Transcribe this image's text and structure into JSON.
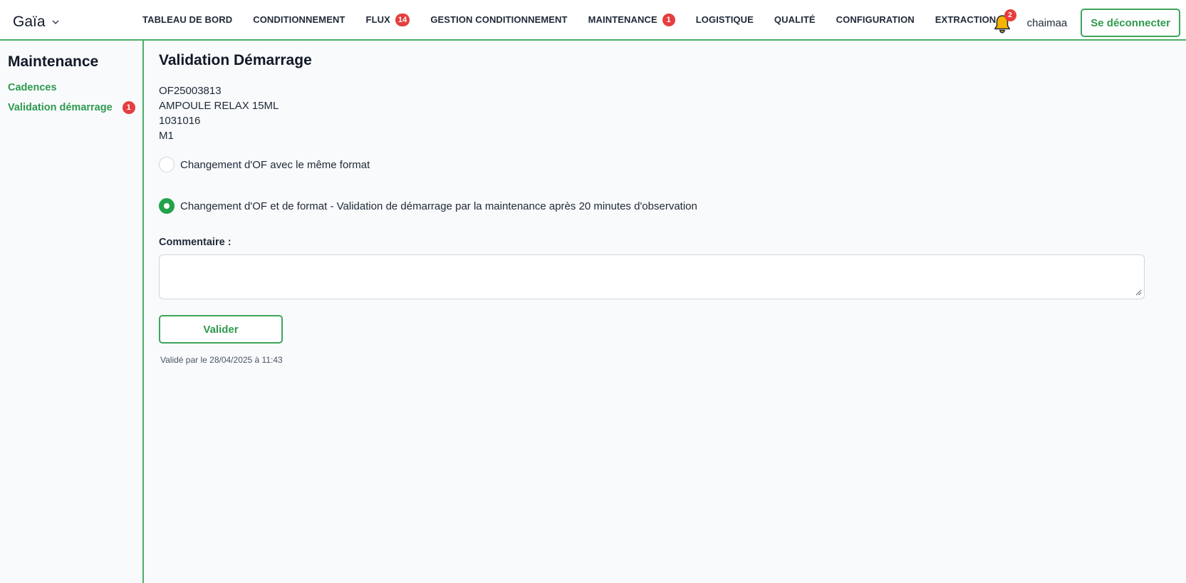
{
  "app": {
    "brand": "Gaïa"
  },
  "nav": {
    "items": [
      {
        "label": "TABLEAU DE BORD",
        "badge": null
      },
      {
        "label": "CONDITIONNEMENT",
        "badge": null
      },
      {
        "label": "FLUX",
        "badge": "14"
      },
      {
        "label": "GESTION CONDITIONNEMENT",
        "badge": null
      },
      {
        "label": "MAINTENANCE",
        "badge": "1"
      },
      {
        "label": "LOGISTIQUE",
        "badge": null
      },
      {
        "label": "QUALITÉ",
        "badge": null
      },
      {
        "label": "CONFIGURATION",
        "badge": null
      },
      {
        "label": "EXTRACTION",
        "badge": null
      }
    ]
  },
  "header": {
    "notifications_count": "2",
    "username": "chaimaa",
    "logout_label": "Se déconnecter"
  },
  "sidebar": {
    "title": "Maintenance",
    "items": [
      {
        "label": "Cadences",
        "badge": null
      },
      {
        "label": "Validation démarrage",
        "badge": "1"
      }
    ]
  },
  "main": {
    "title": "Validation Démarrage",
    "info": [
      "OF25003813",
      "AMPOULE RELAX 15ML",
      "1031016",
      "M1"
    ],
    "options": [
      {
        "label": "Changement d'OF avec le même format",
        "checked": false
      },
      {
        "label": "Changement d'OF et de format - Validation de démarrage par la maintenance après 20 minutes d'observation",
        "checked": true
      }
    ],
    "comment_label": "Commentaire :",
    "comment_value": "",
    "validate_label": "Valider",
    "validated_text": "Validé par le 28/04/2025 à 11:43"
  },
  "colors": {
    "accent": "#2f9a4f",
    "badge": "#e53e3e",
    "bell": "#f5b400"
  },
  "icons": {
    "brand_dropdown": "chevron-down-icon",
    "notifications": "bell-icon"
  }
}
